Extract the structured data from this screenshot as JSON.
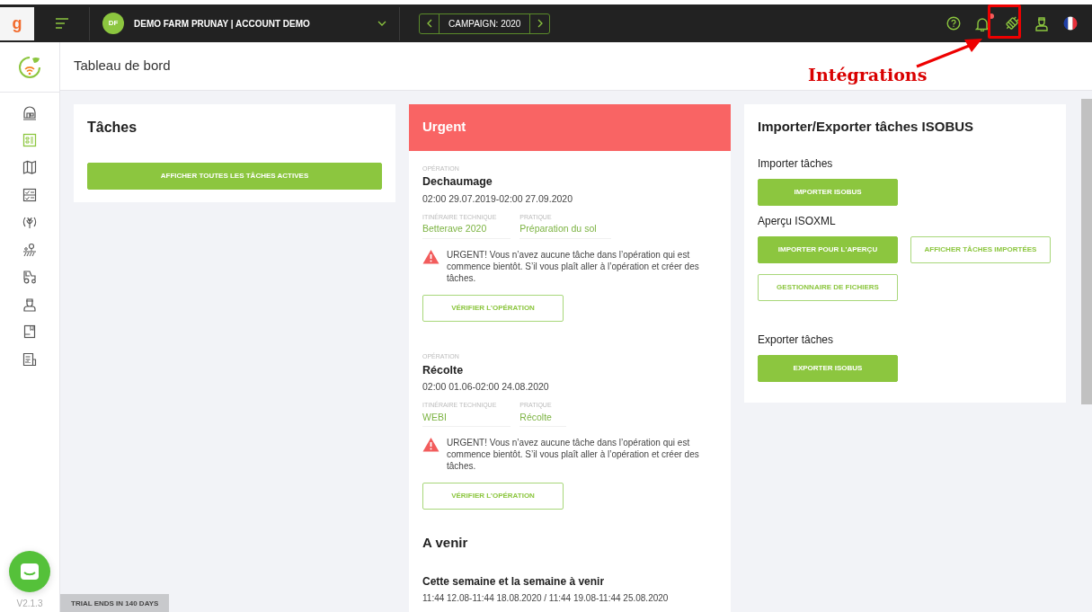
{
  "topbar": {
    "logo": "g",
    "farm": {
      "initials": "DF",
      "name": "DEMO FARM PRUNAY | ACCOUNT DEMO"
    },
    "campaign": "CAMPAIGN: 2020",
    "notifications_unread": true
  },
  "annotation": {
    "label": "Intégrations"
  },
  "page_title": "Tableau de bord",
  "sidebar": {
    "items": [
      {
        "selected": false
      },
      {
        "selected": true
      },
      {
        "selected": false
      },
      {
        "selected": false
      },
      {
        "selected": false
      },
      {
        "selected": false
      },
      {
        "selected": false
      },
      {
        "selected": false
      },
      {
        "selected": false
      },
      {
        "selected": false
      }
    ],
    "version": "V2.1.3"
  },
  "trial": "TRIAL ENDS IN 140 DAYS",
  "tasks_card": {
    "title": "Tâches",
    "button": "AFFICHER TOUTES LES TÂCHES ACTIVES"
  },
  "urgent_card": {
    "title": "Urgent",
    "operations": [
      {
        "label": "OPÉRATION",
        "name": "Dechaumage",
        "dates": "02:00 29.07.2019-02:00 27.09.2020",
        "crumbs": [
          {
            "label": "ITINÉRAIRE TECHNIQUE",
            "value": "Betterave 2020"
          },
          {
            "label": "PRATIQUE",
            "value": "Préparation du sol"
          }
        ],
        "warning": "URGENT! Vous n’avez aucune tâche dans l’opération qui est commence bientôt. S’il vous plaît aller à l’opération et créer des tâches.",
        "button": "VÉRIFIER L’OPÉRATION"
      },
      {
        "label": "OPÉRATION",
        "name": "Récolte",
        "dates": "02:00 01.06-02:00 24.08.2020",
        "crumbs": [
          {
            "label": "ITINÉRAIRE TECHNIQUE",
            "value": "WEBI"
          },
          {
            "label": "PRATIQUE",
            "value": "Récolte"
          }
        ],
        "warning": "URGENT! Vous n’avez aucune tâche dans l’opération qui est commence bientôt. S’il vous plaît aller à l’opération et créer des tâches.",
        "button": "VÉRIFIER L’OPÉRATION"
      }
    ],
    "upcoming": {
      "title": "A venir",
      "period": "Cette semaine et la semaine à venir",
      "dates": "11:44 12.08-11:44 18.08.2020 / 11:44 19.08-11:44 25.08.2020"
    }
  },
  "isobus_card": {
    "title": "Importer/Exporter tâches ISOBUS",
    "sections": [
      {
        "title": "Importer tâches",
        "buttons": [
          {
            "label": "IMPORTER ISOBUS",
            "kind": "filled"
          }
        ]
      },
      {
        "title": "Aperçu ISOXML",
        "buttons": [
          {
            "label": "IMPORTER POUR L'APERÇU",
            "kind": "filled"
          },
          {
            "label": "AFFICHER TÂCHES IMPORTÉES",
            "kind": "outline"
          },
          {
            "label": "GESTIONNAIRE DE FICHIERS",
            "kind": "outline"
          }
        ]
      },
      {
        "title": "Exporter tâches",
        "buttons": [
          {
            "label": "EXPORTER ISOBUS",
            "kind": "filled"
          }
        ]
      }
    ]
  }
}
